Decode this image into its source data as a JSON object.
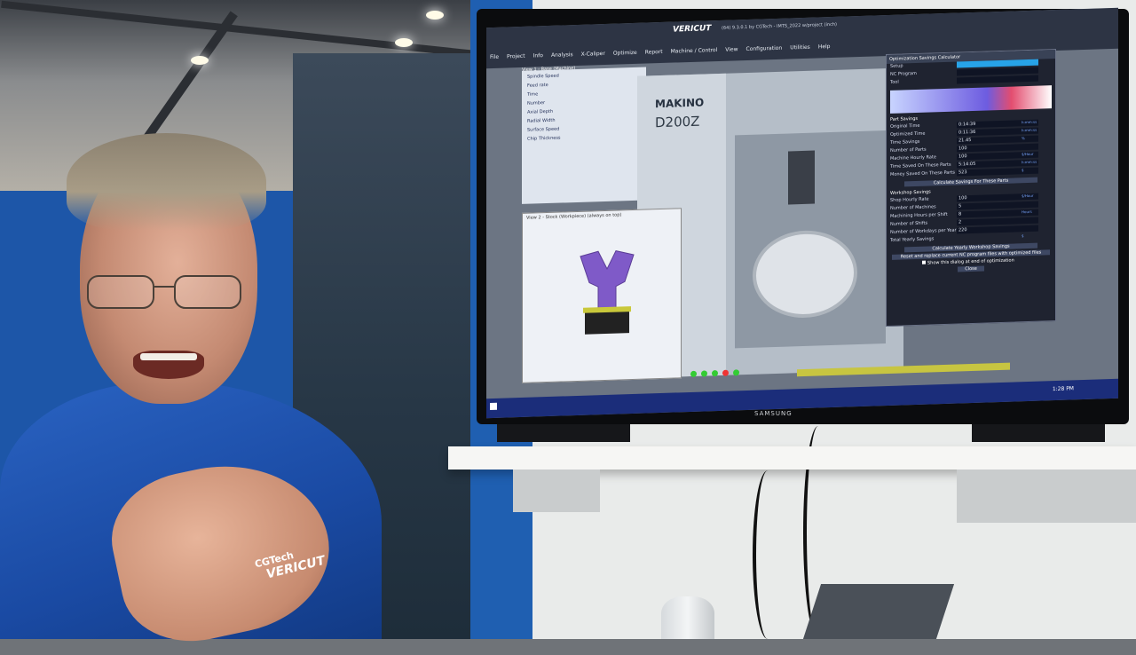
{
  "tv": {
    "brand": "SAMSUNG",
    "app_title": "VERICUT",
    "window_caption": "(64) 9.3.0.1 by CGTech - IMTS_2022 w/project (inch)",
    "menu": [
      "File",
      "Project",
      "Info",
      "Analysis",
      "X-Caliper",
      "Optimize",
      "Report",
      "Machine / Control",
      "View",
      "Configuration",
      "Utilities",
      "Help"
    ],
    "view1_title": "View 1 - Base (Machine)",
    "view2_title": "View 2 - Stock (Workpiece) (always on top)",
    "left_panel_rows": [
      "Spindle Speed",
      "Feed rate",
      "Time",
      "Number",
      "Axial Depth",
      "Radial Width",
      "Surface Speed",
      "Chip Thickness"
    ],
    "machine_brand": "MAKINO",
    "machine_model": "D200Z",
    "dialog": {
      "title": "Optimization Savings Calculator",
      "fields_top": [
        "Setup",
        "NC Program",
        "Tool"
      ],
      "part_savings_heading": "Part Savings",
      "part_rows": [
        {
          "label": "Original Time",
          "value": "0:14:39",
          "unit": "h:mm:ss"
        },
        {
          "label": "Optimized Time",
          "value": "0:11:36",
          "unit": "h:mm:ss"
        },
        {
          "label": "Time Savings",
          "value": "21.45",
          "unit": "%"
        },
        {
          "label": "Number of Parts",
          "value": "100",
          "unit": ""
        },
        {
          "label": "Machine Hourly Rate",
          "value": "100",
          "unit": "$/Hour"
        },
        {
          "label": "Time Saved On These Parts",
          "value": "5:14:05",
          "unit": "h:mm:ss"
        },
        {
          "label": "Money Saved On These Parts",
          "value": "523",
          "unit": "$"
        }
      ],
      "calc_parts_button": "Calculate Savings For These Parts",
      "workshop_heading": "Workshop Savings",
      "workshop_rows": [
        {
          "label": "Shop Hourly Rate",
          "value": "100",
          "unit": "$/Hour"
        },
        {
          "label": "Number of Machines",
          "value": "5",
          "unit": ""
        },
        {
          "label": "Machining Hours per Shift",
          "value": "8",
          "unit": "Hours"
        },
        {
          "label": "Number of Shifts",
          "value": "2",
          "unit": ""
        },
        {
          "label": "Number of Workdays per Year",
          "value": "220",
          "unit": ""
        },
        {
          "label": "Total Yearly Savings",
          "value": "",
          "unit": "$"
        }
      ],
      "calc_yearly_button": "Calculate Yearly Workshop Savings",
      "reset_button": "Reset and replace current NC program files with optimized files",
      "show_checkbox": "Show this dialog at end of optimization",
      "close_button": "Close"
    },
    "taskbar_clock": "1:28 PM"
  },
  "shirt_logo": {
    "line1": "CGTech",
    "line2": "VERICUT"
  },
  "colors": {
    "shirt": "#1a4aa3",
    "dialog_bg": "#1f2330",
    "taskbar": "#1b2d7a",
    "progress": "#c7c541"
  }
}
